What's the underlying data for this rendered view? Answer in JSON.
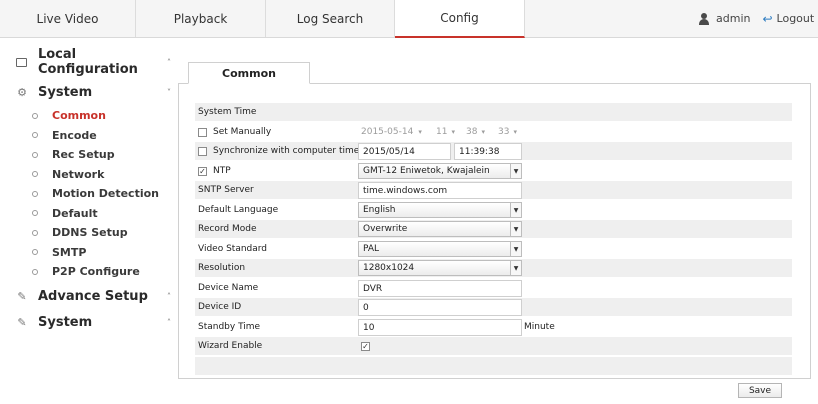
{
  "topnav": {
    "tabs": [
      {
        "label": "Live Video"
      },
      {
        "label": "Playback"
      },
      {
        "label": "Log Search"
      },
      {
        "label": "Config"
      }
    ],
    "active_tab": "Config",
    "user": "admin",
    "logout_label": "Logout"
  },
  "sidebar": {
    "groups": [
      {
        "label": "Local Configuration",
        "caret": "^"
      },
      {
        "label": "System",
        "caret": "v"
      },
      {
        "label": "Advance Setup",
        "caret": "^"
      },
      {
        "label": "System",
        "caret": "^"
      }
    ],
    "items": [
      {
        "label": "Common"
      },
      {
        "label": "Encode"
      },
      {
        "label": "Rec Setup"
      },
      {
        "label": "Network"
      },
      {
        "label": "Motion Detection"
      },
      {
        "label": "Default"
      },
      {
        "label": "DDNS Setup"
      },
      {
        "label": "SMTP"
      },
      {
        "label": "P2P Configure"
      }
    ],
    "active_item": "Common"
  },
  "content": {
    "tab_label": "Common",
    "system_time_label": "System Time",
    "set_manually": {
      "label": "Set Manually",
      "checked": false,
      "date": "2015-05-14",
      "hour": "11",
      "minute": "38",
      "second": "33"
    },
    "sync_computer": {
      "label": "Synchronize with computer time",
      "checked": false,
      "date": "2015/05/14",
      "time": "11:39:38"
    },
    "ntp": {
      "label": "NTP",
      "checked": true,
      "timezone": "GMT-12 Eniwetok, Kwajalein"
    },
    "sntp_server": {
      "label": "SNTP Server",
      "value": "time.windows.com"
    },
    "default_language": {
      "label": "Default Language",
      "value": "English"
    },
    "record_mode": {
      "label": "Record Mode",
      "value": "Overwrite"
    },
    "video_standard": {
      "label": "Video Standard",
      "value": "PAL"
    },
    "resolution": {
      "label": "Resolution",
      "value": "1280x1024"
    },
    "device_name": {
      "label": "Device Name",
      "value": "DVR"
    },
    "device_id": {
      "label": "Device ID",
      "value": "0"
    },
    "standby_time": {
      "label": "Standby Time",
      "value": "10",
      "unit": "Minute"
    },
    "wizard_enable": {
      "label": "Wizard Enable",
      "checked": true
    },
    "save_label": "Save"
  },
  "glyphs": {
    "dropdown_arrow": "▼",
    "small_arrow": "▾",
    "check": "✓"
  },
  "colors": {
    "accent": "#c8322a",
    "row_shade": "#efefef",
    "link_blue": "#2d7cc1"
  }
}
